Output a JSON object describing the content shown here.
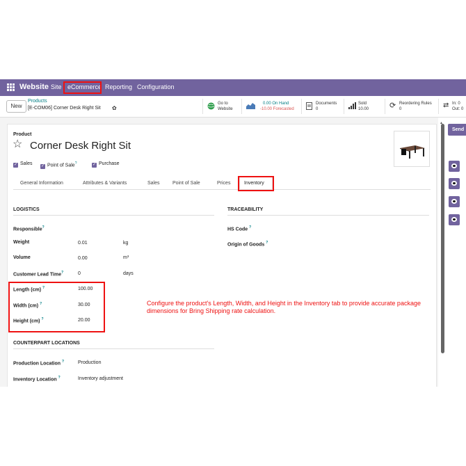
{
  "navbar": {
    "app_name": "Website",
    "menu": [
      "Site",
      "eCommerce",
      "Reporting",
      "Configuration"
    ]
  },
  "control": {
    "new_label": "New",
    "breadcrumb_parent": "Products",
    "breadcrumb_current": "[E-COM06] Corner Desk Right Sit"
  },
  "smart_buttons": {
    "goto": {
      "line1": "Go to",
      "line2": "Website"
    },
    "onhand": {
      "line1": "0.00 On Hand",
      "line2": "-10.00 Forecasted"
    },
    "documents": {
      "line1": "Documents",
      "line2": "0"
    },
    "sold": {
      "line1": "Sold",
      "line2": "10.00"
    },
    "reordering": {
      "line1": "Reordering Rules",
      "line2": "0"
    },
    "inout": {
      "line1": "In: 0",
      "line2": "Out: 0"
    }
  },
  "form": {
    "product_label": "Product",
    "title": "Corner Desk Right Sit",
    "checkboxes": [
      "Sales",
      "Point of Sale",
      "Purchase"
    ],
    "tabs": [
      "General Information",
      "Attributes & Variants",
      "Sales",
      "Point of Sale",
      "Prices",
      "Inventory"
    ]
  },
  "logistics": {
    "heading": "LOGISTICS",
    "responsible_label": "Responsible",
    "weight_label": "Weight",
    "weight_value": "0.01",
    "weight_unit": "kg",
    "volume_label": "Volume",
    "volume_value": "0.00",
    "volume_unit": "m³",
    "lead_label": "Customer Lead Time",
    "lead_value": "0",
    "lead_unit": "days",
    "length_label": "Length (cm)",
    "length_value": "100.00",
    "width_label": "Width (cm)",
    "width_value": "30.00",
    "height_label": "Height (cm)",
    "height_value": "20.00"
  },
  "traceability": {
    "heading": "TRACEABILITY",
    "hs_code_label": "HS Code",
    "origin_label": "Origin of Goods"
  },
  "counterpart": {
    "heading": "COUNTERPART LOCATIONS",
    "production_label": "Production Location",
    "production_value": "Production",
    "inventory_label": "Inventory Location",
    "inventory_value": "Inventory adjustment"
  },
  "annotation": "Configure the product's Length, Width, and Height in the Inventory tab to provide accurate package dimensions for Bring Shipping rate calculation.",
  "chatter": {
    "send_label": "Send"
  },
  "colors": {
    "navbar": "#71639e",
    "highlight": "#e11111",
    "link": "#017e84",
    "forecast_negative": "#d9534f"
  }
}
